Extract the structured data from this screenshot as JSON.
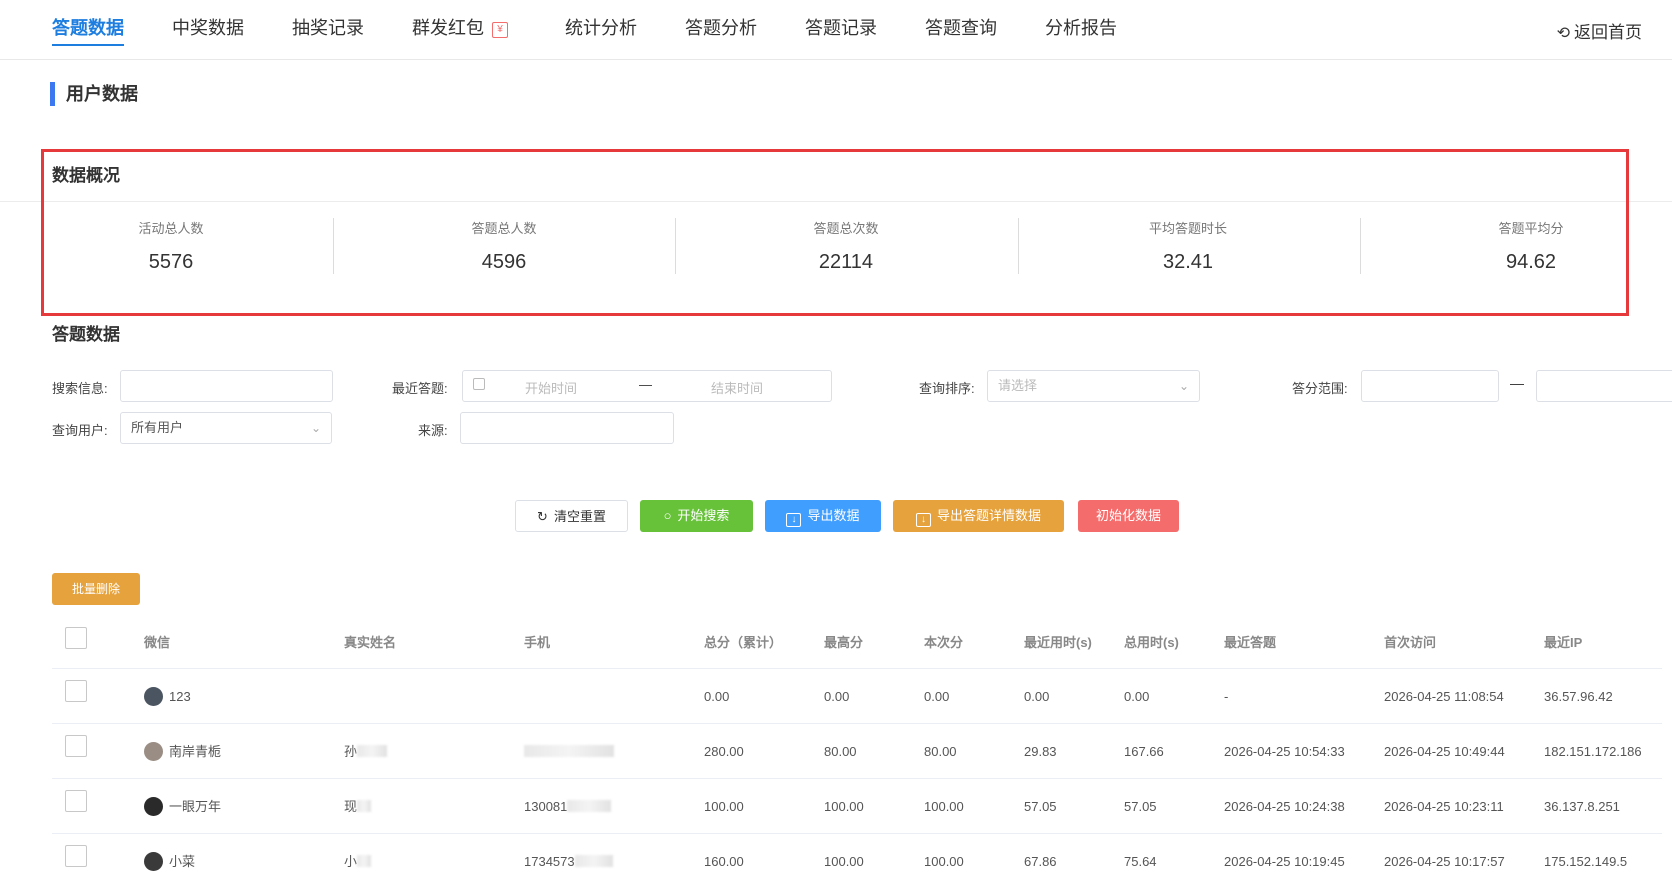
{
  "nav": {
    "tabs": [
      {
        "label": "答题数据",
        "active": true
      },
      {
        "label": "中奖数据"
      },
      {
        "label": "抽奖记录"
      },
      {
        "label": "群发红包",
        "badge": "¥"
      },
      {
        "label": "统计分析"
      },
      {
        "label": "答题分析"
      },
      {
        "label": "答题记录"
      },
      {
        "label": "答题查询"
      },
      {
        "label": "分析报告"
      }
    ],
    "return_home": "返回首页"
  },
  "section_title": "用户数据",
  "overview": {
    "title": "数据概况",
    "stats": [
      {
        "label": "活动总人数",
        "value": "5576"
      },
      {
        "label": "答题总人数",
        "value": "4596"
      },
      {
        "label": "答题总次数",
        "value": "22114"
      },
      {
        "label": "平均答题时长",
        "value": "32.41"
      },
      {
        "label": "答题平均分",
        "value": "94.62"
      }
    ]
  },
  "answer_data": {
    "title": "答题数据",
    "filters": {
      "search_label": "搜索信息:",
      "recent_label": "最近答题:",
      "start_placeholder": "开始时间",
      "range_dash": "—",
      "end_placeholder": "结束时间",
      "sort_label": "查询排序:",
      "sort_placeholder": "请选择",
      "score_label": "答分范围:",
      "score_dash": "—",
      "user_label": "查询用户:",
      "user_value": "所有用户",
      "source_label": "来源:"
    },
    "buttons": {
      "reset": "清空重置",
      "search": "开始搜索",
      "export": "导出数据",
      "export_detail": "导出答题详情数据",
      "init": "初始化数据",
      "batch_delete": "批量删除"
    }
  },
  "table": {
    "headers": [
      "微信",
      "真实姓名",
      "手机",
      "总分（累计）",
      "最高分",
      "本次分",
      "最近用时(s)",
      "总用时(s)",
      "最近答题",
      "首次访问",
      "最近IP"
    ],
    "rows": [
      {
        "wechat": "123",
        "avatar_color": "#4a5561",
        "name": "",
        "phone": "",
        "total": "0.00",
        "max": "0.00",
        "current": "0.00",
        "recent_time": "0.00",
        "total_time": "0.00",
        "recent_answer": "-",
        "first_visit": "2026-04-25 11:08:54",
        "ip": "36.57.96.42"
      },
      {
        "wechat": "南岸青栀",
        "avatar_color": "#9a8d84",
        "name": "孙",
        "phone": "",
        "total": "280.00",
        "max": "80.00",
        "current": "80.00",
        "recent_time": "29.83",
        "total_time": "167.66",
        "recent_answer": "2026-04-25 10:54:33",
        "first_visit": "2026-04-25 10:49:44",
        "ip": "182.151.172.186"
      },
      {
        "wechat": "一眼万年",
        "avatar_color": "#2a2a2a",
        "name": "现",
        "phone": "130081",
        "total": "100.00",
        "max": "100.00",
        "current": "100.00",
        "recent_time": "57.05",
        "total_time": "57.05",
        "recent_answer": "2026-04-25 10:24:38",
        "first_visit": "2026-04-25 10:23:11",
        "ip": "36.137.8.251"
      },
      {
        "wechat": "小菜",
        "avatar_color": "#3a3a3a",
        "name": "小",
        "phone": "1734573",
        "total": "160.00",
        "max": "100.00",
        "current": "100.00",
        "recent_time": "67.86",
        "total_time": "75.64",
        "recent_answer": "2026-04-25 10:19:45",
        "first_visit": "2026-04-25 10:17:57",
        "ip": "175.152.149.5"
      }
    ]
  }
}
